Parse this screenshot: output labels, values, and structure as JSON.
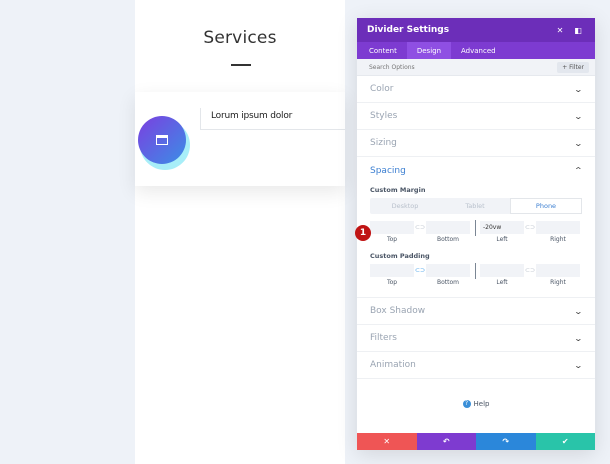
{
  "canvas": {
    "heading": "Services",
    "card_title": "Lorum ipsum dolor",
    "card_icon": "browser-window-icon"
  },
  "panel": {
    "title": "Divider Settings",
    "header_icons": [
      "close-icon",
      "sidebar-toggle-icon"
    ],
    "tabs": [
      {
        "label": "Content",
        "active": false
      },
      {
        "label": "Design",
        "active": true
      },
      {
        "label": "Advanced",
        "active": false
      }
    ],
    "search_placeholder": "Search Options",
    "filter_label": "+ Filter",
    "sections_before": [
      "Color",
      "Styles",
      "Sizing"
    ],
    "spacing": {
      "title": "Spacing",
      "margin_label": "Custom Margin",
      "devices": [
        "Desktop",
        "Tablet",
        "Phone"
      ],
      "active_device": "Phone",
      "margin_values": {
        "top": "",
        "bottom": "",
        "left": "-20vw",
        "right": ""
      },
      "padding_label": "Custom Padding",
      "padding_values": {
        "top": "",
        "bottom": "",
        "left": "",
        "right": ""
      },
      "side_labels": [
        "Top",
        "Bottom",
        "Left",
        "Right"
      ]
    },
    "sections_after": [
      "Box Shadow",
      "Filters",
      "Animation"
    ],
    "help_label": "Help",
    "actions": [
      {
        "name": "discard",
        "icon": "x-icon"
      },
      {
        "name": "undo",
        "icon": "undo-icon"
      },
      {
        "name": "redo",
        "icon": "redo-icon"
      },
      {
        "name": "save",
        "icon": "check-icon"
      }
    ]
  },
  "marker": {
    "label": "1"
  },
  "colors": {
    "panel_header": "#6c2eb9",
    "tab_bar": "#7d3bd1",
    "accent_blue": "#3c7fd1",
    "discard": "#ef5555",
    "undo": "#7e3bd0",
    "redo": "#2b87da",
    "save": "#29c4a9",
    "marker": "#c01414"
  }
}
